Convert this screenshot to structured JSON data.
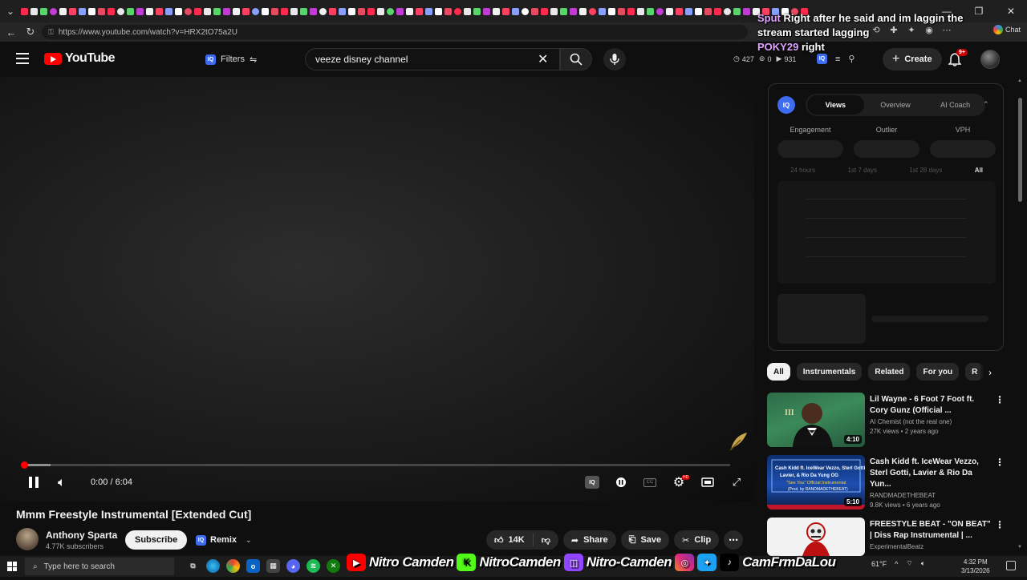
{
  "browser": {
    "url": "https://www.youtube.com/watch?v=HRX2tO75a2U"
  },
  "chat_overlay": {
    "messages": [
      {
        "user": "Sput",
        "text": "Right after he said and im laggin the stream started lagging"
      },
      {
        "user": "POKY29",
        "text": "right"
      }
    ]
  },
  "header": {
    "logo_text": "YouTube",
    "filters_label": "Filters",
    "search_value": "veeze disney channel",
    "stat_views": "427",
    "stat_zero": "0",
    "stat_count": "931",
    "create_label": "Create",
    "notif_count": "9+"
  },
  "player": {
    "time": "0:00 / 6:04",
    "progress_fraction": 0.003,
    "loaded_fraction": 0.037
  },
  "video": {
    "title": "Mmm Freestyle Instrumental [Extended Cut]",
    "channel": "Anthony Sparta",
    "subscribers": "4.77K subscribers",
    "subscribe_label": "Subscribe",
    "remix_label": "Remix",
    "likes": "14K",
    "share_label": "Share",
    "save_label": "Save",
    "clip_label": "Clip"
  },
  "iq_panel": {
    "logo": "IQ",
    "tabs": [
      "Views",
      "Overview",
      "AI Coach"
    ],
    "active_tab": "Views",
    "metrics": [
      "Engagement",
      "Outlier",
      "VPH"
    ],
    "time_ranges": [
      "24 hours",
      "1st 7 days",
      "1st 28 days",
      "All"
    ],
    "active_range": "All"
  },
  "chips": [
    "All",
    "Instrumentals",
    "Related",
    "For you",
    "R"
  ],
  "recommendations": [
    {
      "title": "Lil Wayne - 6 Foot 7 Foot ft. Cory Gunz (Official ...",
      "channel": "AI Chemist (not the real one)",
      "meta": "27K views • 2 years ago",
      "duration": "4:10"
    },
    {
      "title": "Cash Kidd ft. IceWear Vezzo, Sterl Gotti, Lavier & Rio Da Yun...",
      "channel": "RANDMADETHEBEAT",
      "meta": "9.8K views • 6 years ago",
      "duration": "5:10"
    },
    {
      "title": "FREESTYLE BEAT - \"ON BEAT\" | Diss Rap Instrumental | ...",
      "channel": "ExperimentalBeatz",
      "meta": "",
      "duration": ""
    }
  ],
  "taskbar": {
    "search_placeholder": "Type here to search",
    "weather": "61°F",
    "time": "4:32 PM",
    "date": "3/13/2026"
  },
  "social_overlay": {
    "youtube": "Nitro Camden",
    "kick": "NitroCamden",
    "twitch": "Nitro-Camden",
    "other": "CamFrmDaLou"
  },
  "colors": {
    "yt_red": "#ff0000",
    "iq_blue": "#3d6cf0",
    "bg": "#0f0f0f"
  }
}
